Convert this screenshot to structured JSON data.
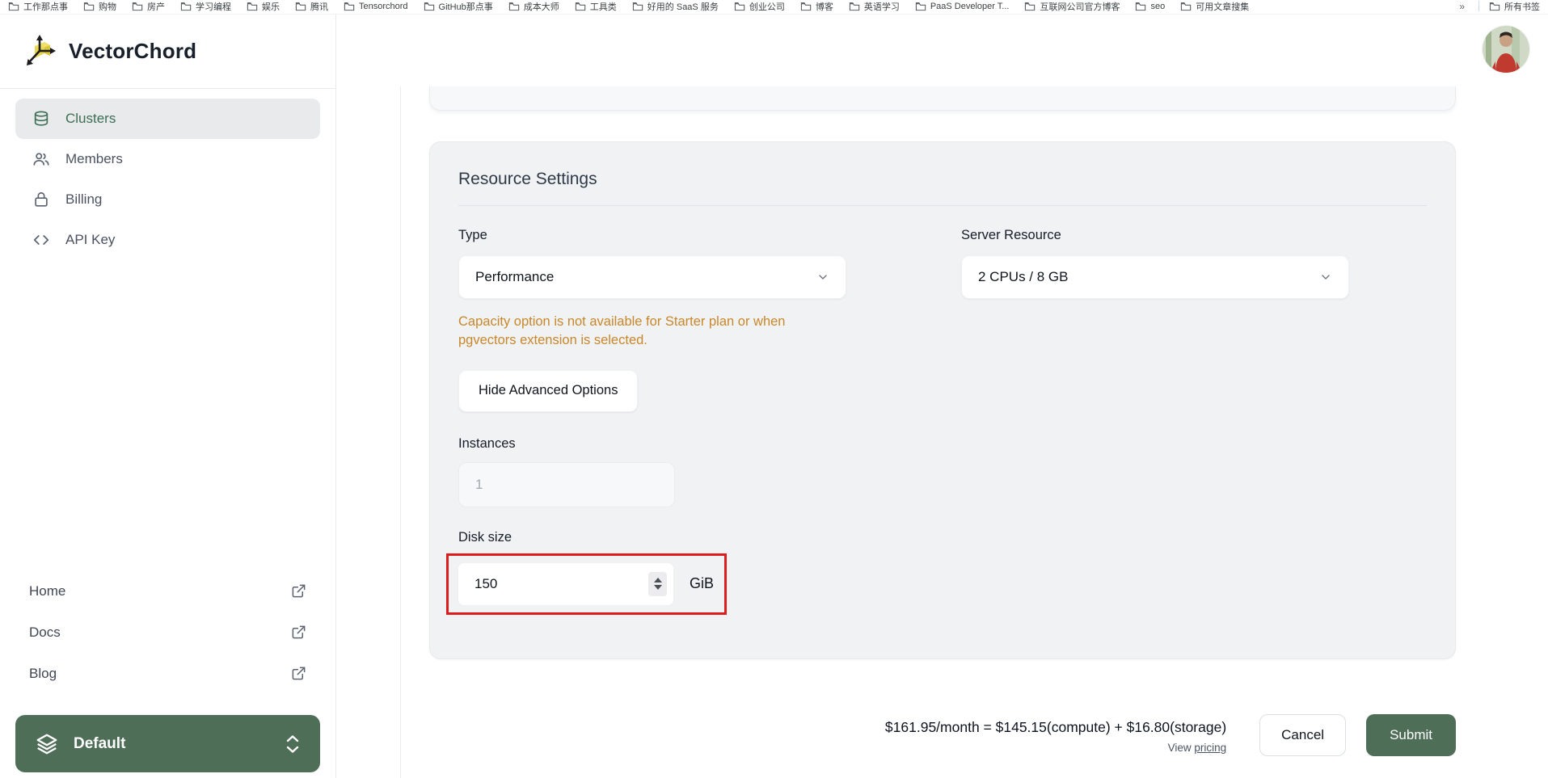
{
  "bookmarks": {
    "items": [
      "工作那点事",
      "购物",
      "房产",
      "学习编程",
      "娱乐",
      "腾讯",
      "Tensorchord",
      "GitHub那点事",
      "成本大师",
      "工具类",
      "好用的 SaaS 服务",
      "创业公司",
      "博客",
      "英语学习",
      "PaaS Developer T...",
      "互联网公司官方博客",
      "seo",
      "可用文章搜集"
    ],
    "more_chevron": "»",
    "all_bookmarks": "所有书签"
  },
  "sidebar": {
    "brand": "VectorChord",
    "nav": [
      {
        "label": "Clusters",
        "icon": "database-icon",
        "active": true
      },
      {
        "label": "Members",
        "icon": "users-icon",
        "active": false
      },
      {
        "label": "Billing",
        "icon": "lock-icon",
        "active": false
      },
      {
        "label": "API Key",
        "icon": "code-icon",
        "active": false
      }
    ],
    "links": [
      {
        "label": "Home"
      },
      {
        "label": "Docs"
      },
      {
        "label": "Blog"
      }
    ],
    "workspace": {
      "label": "Default"
    }
  },
  "panel": {
    "title": "Resource Settings",
    "type_label": "Type",
    "type_value": "Performance",
    "server_label": "Server Resource",
    "server_value": "2 CPUs / 8 GB",
    "warning": "Capacity option is not available for Starter plan or when pgvectors extension is selected.",
    "advanced_button": "Hide Advanced Options",
    "instances_label": "Instances",
    "instances_value": "1",
    "disk_label": "Disk size",
    "disk_value": "150",
    "disk_unit": "GiB"
  },
  "footer": {
    "price_summary": "$161.95/month = $145.15(compute) + $16.80(storage)",
    "view_text": "View",
    "pricing_link": "pricing",
    "cancel": "Cancel",
    "submit": "Submit"
  },
  "colors": {
    "accent_green": "#4e6e58",
    "active_nav_green": "#3c6e54",
    "warning_orange": "#c8872b",
    "annotation_red": "#dd1b1b",
    "card_bg": "#f1f2f4",
    "logo_yellow": "#e8d44d"
  }
}
